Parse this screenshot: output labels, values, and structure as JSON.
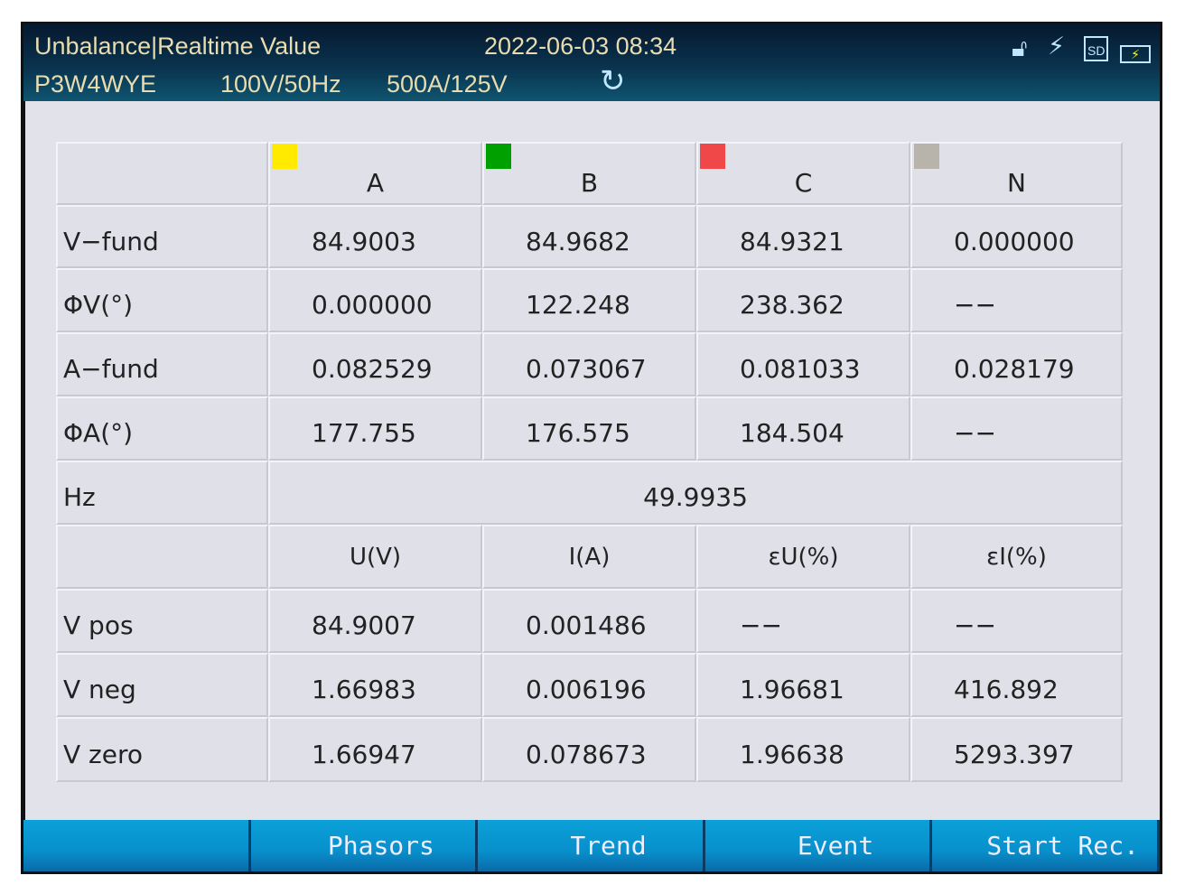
{
  "header": {
    "title": "Unbalance|Realtime  Value",
    "datetime": "2022-06-03  08:34",
    "wiring": "P3W4WYE",
    "nominal": "100V/50Hz",
    "clamp": "500A/125V"
  },
  "colors": {
    "A": "#ffea00",
    "B": "#00a000",
    "C": "#f04848",
    "N": "#b8b4ac"
  },
  "table": {
    "phases": [
      "A",
      "B",
      "C",
      "N"
    ],
    "rows": [
      {
        "label": "V−fund",
        "values": [
          "84.9003",
          "84.9682",
          "84.9321",
          "0.000000"
        ]
      },
      {
        "label": "ΦV(°)",
        "values": [
          "0.000000",
          "122.248",
          "238.362",
          "−−"
        ]
      },
      {
        "label": "A−fund",
        "values": [
          "0.082529",
          "0.073067",
          "0.081033",
          "0.028179"
        ]
      },
      {
        "label": "ΦA(°)",
        "values": [
          "177.755",
          "176.575",
          "184.504",
          "−−"
        ]
      }
    ],
    "hz": {
      "label": "Hz",
      "value": "49.9935"
    },
    "sub_headers": [
      "U(V)",
      "I(A)",
      "εU(%)",
      "εI(%)"
    ],
    "seq_rows": [
      {
        "label": "V  pos",
        "values": [
          "84.9007",
          "0.001486",
          "−−",
          "−−"
        ]
      },
      {
        "label": "V  neg",
        "values": [
          "1.66983",
          "0.006196",
          "1.96681",
          "416.892"
        ]
      },
      {
        "label": "V  zero",
        "values": [
          "1.66947",
          "0.078673",
          "1.96638",
          "5293.397"
        ]
      }
    ]
  },
  "footer": {
    "buttons": [
      "",
      "Phasors",
      "Trend",
      "Event",
      "Start  Rec."
    ]
  }
}
